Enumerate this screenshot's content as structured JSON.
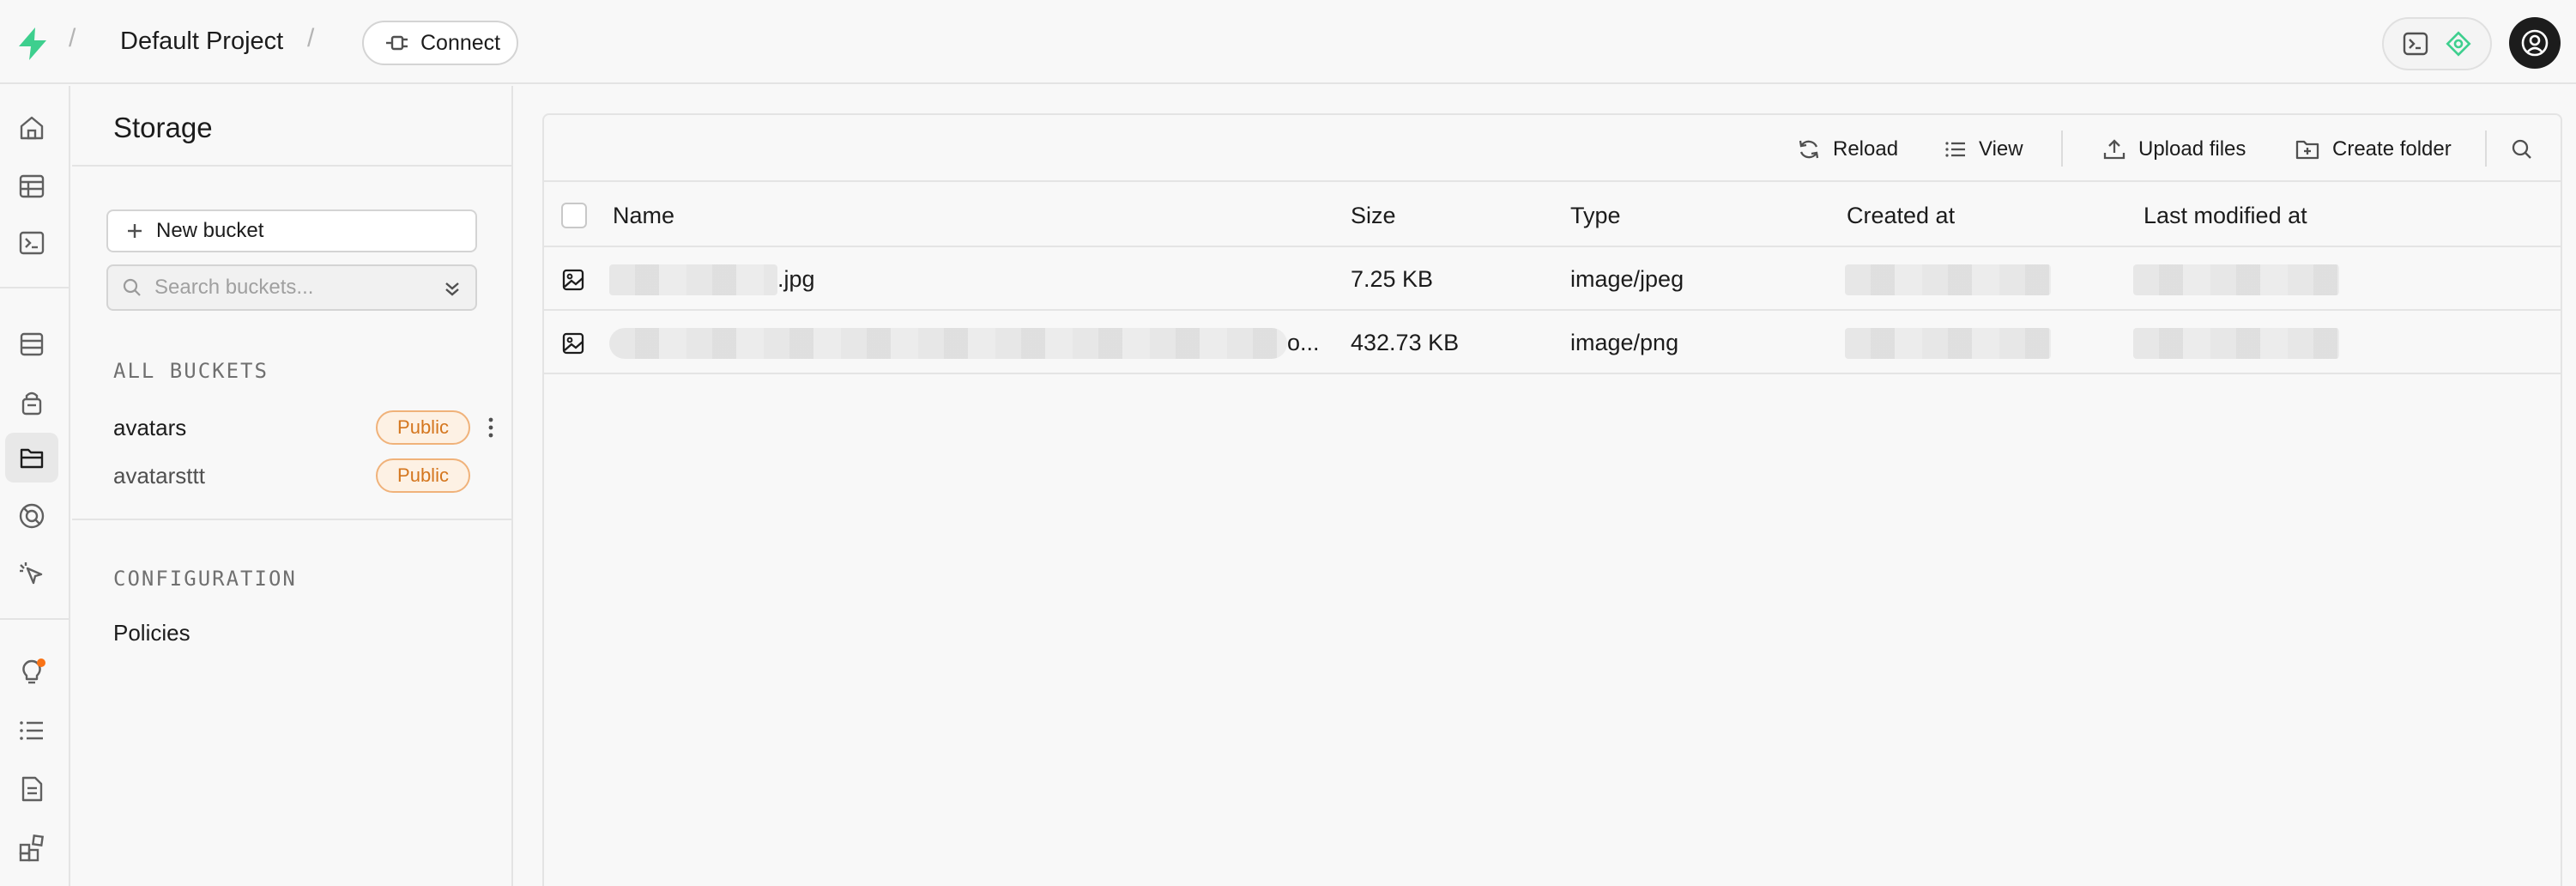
{
  "topbar": {
    "project_name": "Default Project",
    "connect_label": "Connect",
    "brand_color": "#3ecf8e"
  },
  "rail": {
    "icons": [
      "home-icon",
      "table-editor-icon",
      "sql-editor-icon",
      "database-icon",
      "auth-icon",
      "storage-icon",
      "realtime-icon",
      "edge-functions-icon",
      "advisors-icon",
      "logs-icon",
      "api-docs-icon",
      "integrations-icon"
    ],
    "active": "storage-icon",
    "notification_color": "#f97316"
  },
  "sidebar": {
    "title": "Storage",
    "new_bucket_label": "New bucket",
    "search_placeholder": "Search buckets...",
    "all_buckets_label": "ALL BUCKETS",
    "buckets": [
      {
        "name": "avatars",
        "badge": "Public"
      },
      {
        "name": "avatarsttt",
        "badge": "Public"
      }
    ],
    "configuration_label": "CONFIGURATION",
    "policies_label": "Policies",
    "badge_color": "#d4761e"
  },
  "toolbar": {
    "reload_label": "Reload",
    "view_label": "View",
    "upload_label": "Upload files",
    "create_folder_label": "Create folder"
  },
  "table": {
    "headers": {
      "name": "Name",
      "size": "Size",
      "type": "Type",
      "created": "Created at",
      "modified": "Last modified at"
    },
    "rows": [
      {
        "name_suffix": ".jpg",
        "size": "7.25 KB",
        "type": "image/jpeg"
      },
      {
        "name_suffix": "o...",
        "size": "432.73 KB",
        "type": "image/png"
      }
    ]
  }
}
